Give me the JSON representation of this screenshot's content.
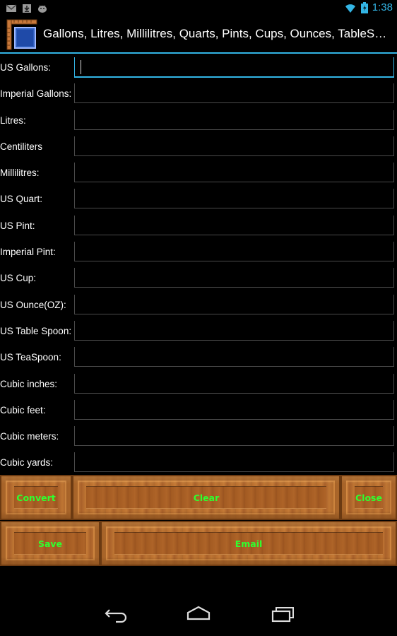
{
  "status_bar": {
    "time": "1:38",
    "icons": [
      "gmail-icon",
      "download-icon",
      "android-icon",
      "wifi-icon",
      "battery-icon"
    ]
  },
  "action_bar": {
    "title": "Gallons, Litres, Millilitres, Quarts, Pints, Cups, Ounces, TableSpoons, TeaSpoons"
  },
  "form": {
    "rows": [
      {
        "label": "US Gallons:",
        "value": ""
      },
      {
        "label": "Imperial Gallons:",
        "value": ""
      },
      {
        "label": "Litres:",
        "value": ""
      },
      {
        "label": "Centiliters",
        "value": ""
      },
      {
        "label": "Millilitres:",
        "value": ""
      },
      {
        "label": "US Quart:",
        "value": ""
      },
      {
        "label": "US Pint:",
        "value": ""
      },
      {
        "label": "Imperial Pint:",
        "value": ""
      },
      {
        "label": "US Cup:",
        "value": ""
      },
      {
        "label": "US Ounce(OZ):",
        "value": ""
      },
      {
        "label": "US Table Spoon:",
        "value": ""
      },
      {
        "label": "US TeaSpoon:",
        "value": ""
      },
      {
        "label": "Cubic inches:",
        "value": ""
      },
      {
        "label": "Cubic feet:",
        "value": ""
      },
      {
        "label": "Cubic meters:",
        "value": ""
      },
      {
        "label": "Cubic yards:",
        "value": ""
      }
    ]
  },
  "buttons": {
    "convert": "Convert",
    "clear": "Clear",
    "close": "Close",
    "save": "Save",
    "email": "Email"
  },
  "colors": {
    "accent": "#33b5e5",
    "button_text": "#2fff2f",
    "wood": "#b86e2e"
  },
  "nav_bar": {
    "icons": [
      "back-icon",
      "home-icon",
      "recents-icon"
    ]
  }
}
